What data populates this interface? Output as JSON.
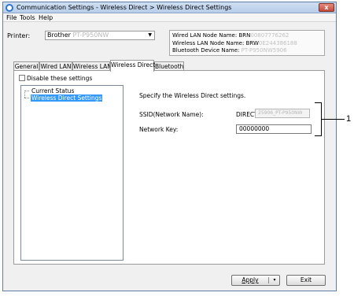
{
  "window": {
    "title": "Communication Settings - Wireless Direct > Wireless Direct Settings",
    "close_label": "x"
  },
  "menu": [
    "File",
    "Tools",
    "Help"
  ],
  "printer": {
    "label": "Printer:",
    "selected_prefix": "Brother",
    "selected_blurred": "PT-P950NW"
  },
  "device_info": {
    "wired_label": "Wired LAN Node Name:",
    "wired_prefix": "BRN",
    "wired_blurred": "00807776262",
    "wireless_label": "Wireless LAN Node Name:",
    "wireless_prefix": "BRW",
    "wireless_blurred": "0E244386188",
    "bluetooth_label": "Bluetooth Device Name:",
    "bluetooth_blurred": "PT-P950NW5906"
  },
  "tabs": [
    "General",
    "Wired LAN",
    "Wireless LAN",
    "Wireless Direct",
    "Bluetooth"
  ],
  "active_tab": "Wireless Direct",
  "disable_checkbox": {
    "label": "Disable these settings",
    "checked": false
  },
  "tree": {
    "items": [
      "Current Status",
      "Wireless Direct Settings"
    ],
    "selected": "Wireless Direct Settings"
  },
  "settings": {
    "description": "Specify the Wireless Direct settings.",
    "ssid_label": "SSID(Network Name):",
    "ssid_prefix": "DIRECT-",
    "ssid_value": "25906_PT-P950NW",
    "key_label": "Network Key:",
    "key_value": "00000000"
  },
  "buttons": {
    "apply": "Apply",
    "apply_dropdown": "▾",
    "exit": "Exit"
  },
  "callout": {
    "number": "1"
  },
  "colors": {
    "selection": "#3399ff",
    "title_bar": "#b7cde9",
    "close_button": "#c44a3a"
  }
}
